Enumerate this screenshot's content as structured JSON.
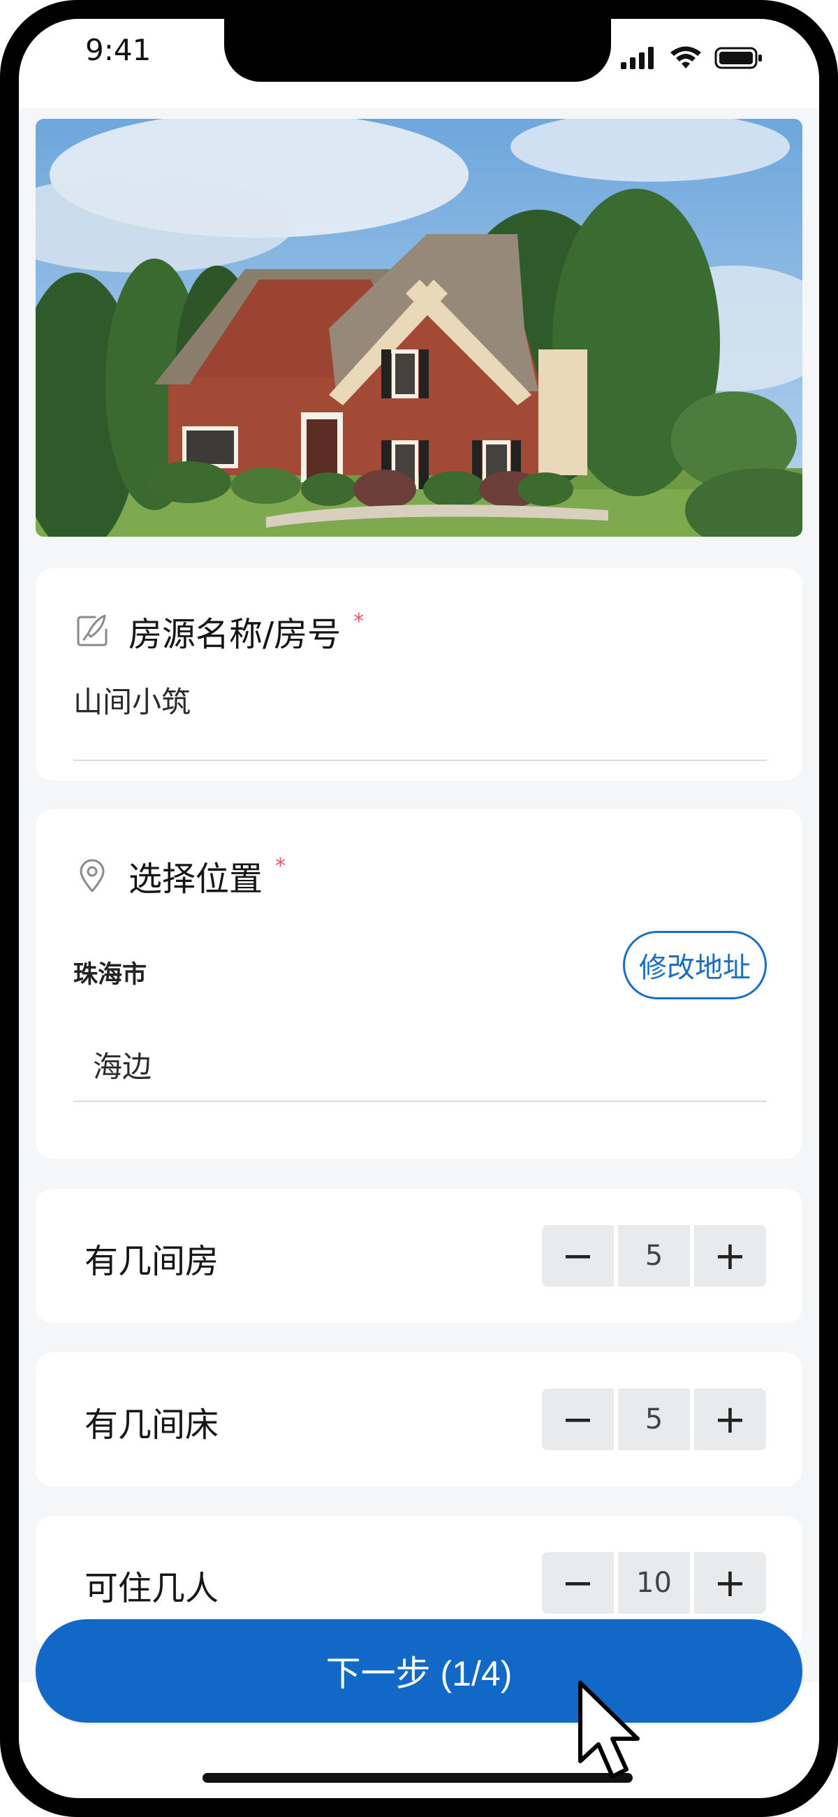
{
  "status_bar": {
    "time": "9:41",
    "icons": [
      "signal-icon",
      "wifi-icon",
      "battery-icon"
    ]
  },
  "hero": {
    "icon": "house-photo"
  },
  "listing_name": {
    "icon": "edit-icon",
    "label": "房源名称/房号",
    "required_mark": "*",
    "value": "山间小筑"
  },
  "location": {
    "icon": "location-pin-icon",
    "label": "选择位置",
    "required_mark": "*",
    "city": "珠海市",
    "edit_button": "修改地址",
    "detail": "海边"
  },
  "counters": [
    {
      "label": "有几间房",
      "value": "5",
      "minus": "−",
      "plus": "+"
    },
    {
      "label": "有几间床",
      "value": "5",
      "minus": "−",
      "plus": "+"
    },
    {
      "label": "可住几人",
      "value": "10",
      "minus": "−",
      "plus": "+"
    }
  ],
  "footer": {
    "next_button": "下一步 (1/4)"
  },
  "colors": {
    "primary": "#1168c6",
    "required": "#e05a63",
    "background": "#f5f6f8"
  }
}
